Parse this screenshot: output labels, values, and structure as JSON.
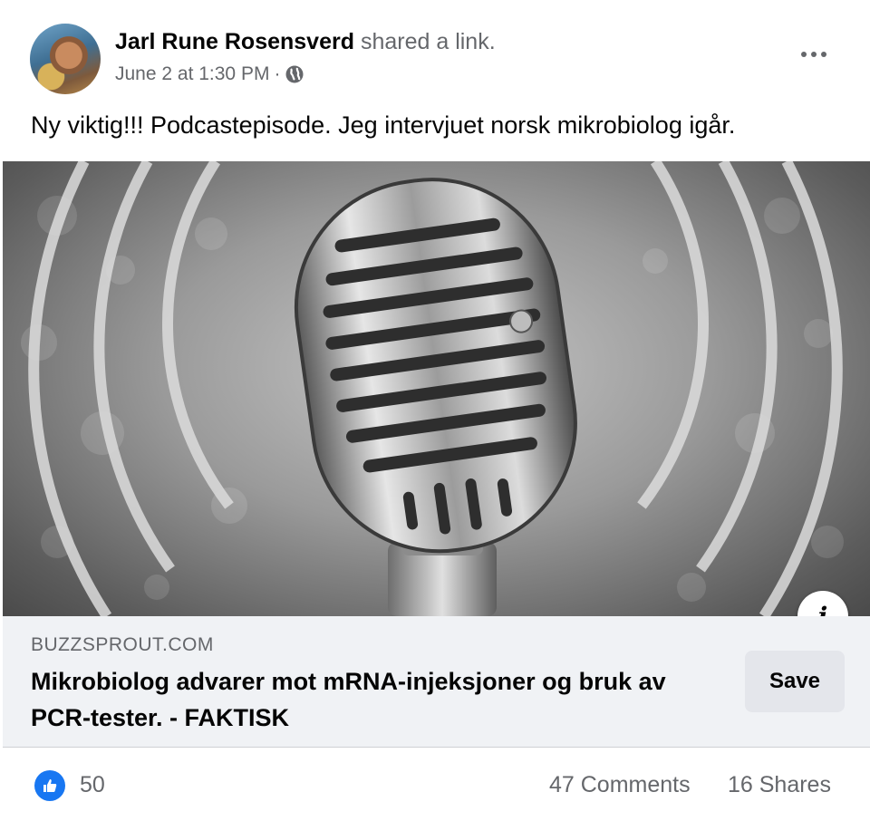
{
  "post": {
    "author_name": "Jarl Rune Rosensverd",
    "action_text": "shared a link.",
    "timestamp": "June 2 at 1:30 PM",
    "separator": "·",
    "privacy_icon": "globe-icon",
    "more_icon": "more-options-icon",
    "text": "Ny viktig!!! Podcastepisode. Jeg intervjuet norsk mikrobiolog igår."
  },
  "link_preview": {
    "image_subject": "vintage-microphone",
    "info_label": "i",
    "domain": "BUZZSPROUT.COM",
    "title": "Mikrobiolog advarer mot mRNA-injeksjoner og bruk av PCR-tester. - FAKTISK",
    "save_label": "Save"
  },
  "reactions": {
    "like_icon": "like-thumb-icon",
    "like_count": "50",
    "comments": "47 Comments",
    "shares": "16 Shares"
  },
  "colors": {
    "accent": "#1877f2",
    "secondary_text": "#65676b",
    "footer_bg": "#f0f2f5",
    "button_bg": "#e4e6eb"
  }
}
